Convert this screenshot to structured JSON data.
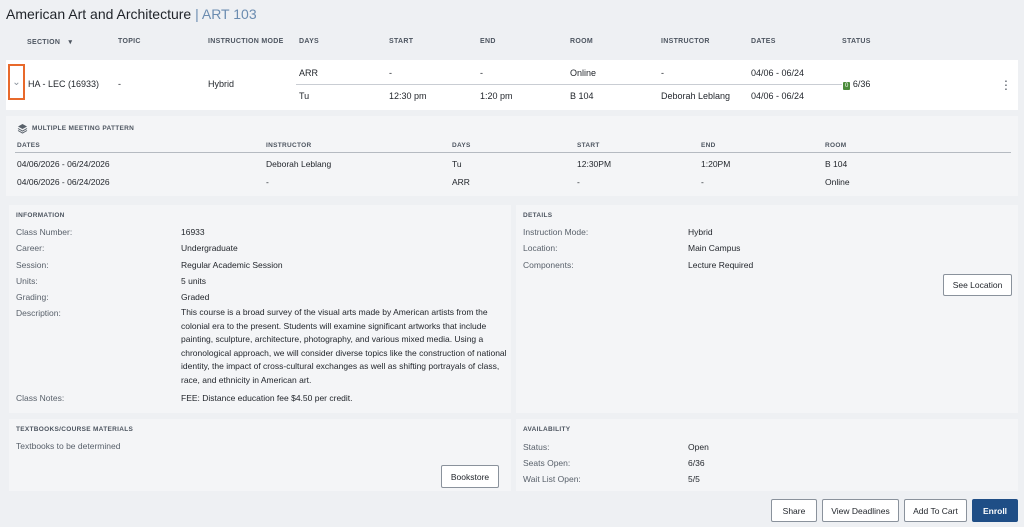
{
  "course": {
    "title": "American Art and Architecture",
    "separator": "|",
    "code": "ART 103"
  },
  "columns": {
    "section": "SECTION",
    "topic": "TOPIC",
    "mode": "INSTRUCTION MODE",
    "days": "DAYS",
    "start": "START",
    "end": "END",
    "room": "ROOM",
    "instructor": "INSTRUCTOR",
    "dates": "DATES",
    "status": "STATUS"
  },
  "section_row": {
    "section": "HA - LEC (16933)",
    "topic": "-",
    "mode": "Hybrid",
    "meetings": [
      {
        "days": "ARR",
        "start": "-",
        "end": "-",
        "room": "Online",
        "instructor": "-",
        "dates": "04/06 - 06/24"
      },
      {
        "days": "Tu",
        "start": "12:30 pm",
        "end": "1:20 pm",
        "room": "B 104",
        "instructor": "Deborah Leblang",
        "dates": "04/06 - 06/24"
      }
    ],
    "status_badge": "0",
    "status_seats": "6/36"
  },
  "meeting_pattern": {
    "title": "MULTIPLE MEETING PATTERN",
    "headers": {
      "dates": "DATES",
      "instructor": "INSTRUCTOR",
      "days": "DAYS",
      "start": "START",
      "end": "END",
      "room": "ROOM"
    },
    "rows": [
      {
        "dates": "04/06/2026 - 06/24/2026",
        "instructor": "Deborah Leblang",
        "days": "Tu",
        "start": "12:30PM",
        "end": "1:20PM",
        "room": "B 104"
      },
      {
        "dates": "04/06/2026 - 06/24/2026",
        "instructor": "-",
        "days": "ARR",
        "start": "-",
        "end": "-",
        "room": "Online"
      }
    ]
  },
  "information": {
    "title": "INFORMATION",
    "class_number_label": "Class Number:",
    "class_number": "16933",
    "career_label": "Career:",
    "career": "Undergraduate",
    "session_label": "Session:",
    "session": "Regular Academic Session",
    "units_label": "Units:",
    "units": "5 units",
    "grading_label": "Grading:",
    "grading": "Graded",
    "description_label": "Description:",
    "description": "This course is a broad survey of the visual arts made by American artists from the colonial era to the present. Students will examine significant artworks that include painting, sculpture, architecture, photography, and various mixed media. Using a chronological approach, we will consider diverse topics like the construction of national identity, the impact of cross-cultural exchanges as well as shifting portrayals of class, race, and ethnicity in American art.",
    "notes_label": "Class Notes:",
    "notes": "FEE: Distance education fee $4.50 per credit."
  },
  "details": {
    "title": "DETAILS",
    "mode_label": "Instruction Mode:",
    "mode": "Hybrid",
    "location_label": "Location:",
    "location": "Main Campus",
    "components_label": "Components:",
    "components": "Lecture Required",
    "see_location": "See Location"
  },
  "textbooks": {
    "title": "TEXTBOOKS/COURSE MATERIALS",
    "text": "Textbooks to be determined",
    "bookstore": "Bookstore"
  },
  "availability": {
    "title": "AVAILABILITY",
    "status_label": "Status:",
    "status": "Open",
    "seats_label": "Seats Open:",
    "seats": "6/36",
    "waitlist_label": "Wait List Open:",
    "waitlist": "5/5"
  },
  "actions": {
    "share": "Share",
    "deadlines": "View Deadlines",
    "cart": "Add To Cart",
    "enroll": "Enroll"
  },
  "colors": {
    "accent": "#1f4e86",
    "highlight": "#e8692b",
    "badge": "#4b8b3b"
  }
}
